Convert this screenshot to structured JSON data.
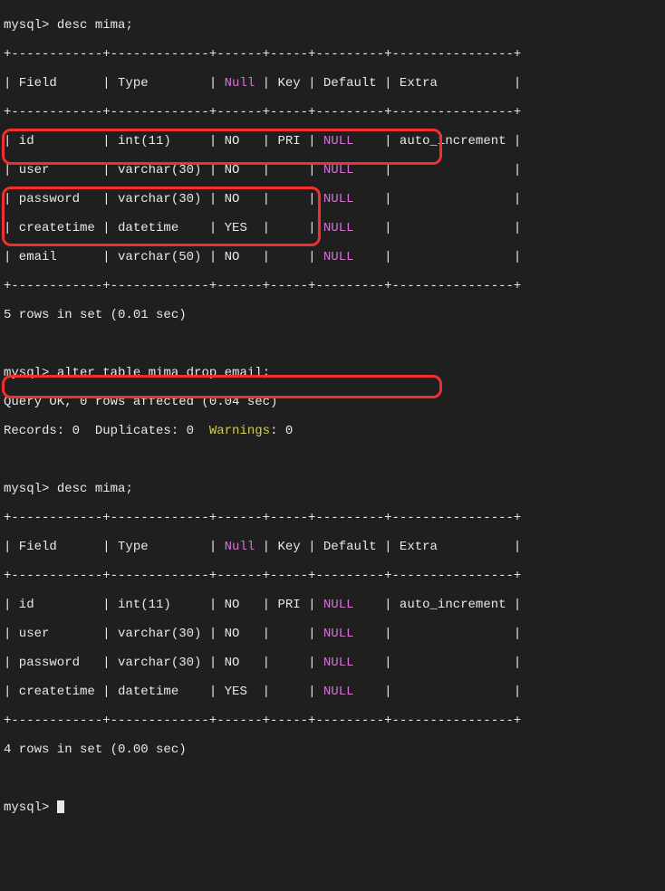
{
  "prompt": "mysql>",
  "cmd_desc": "desc mima;",
  "cmd_alter": "alter table mima drop email;",
  "alter_result1": "Query OK, 0 rows affected (0.04 sec)",
  "records_label": "Records: 0  Duplicates: 0  ",
  "warnings_label": "Warnings",
  "warnings_tail": ": 0",
  "summary1": "5 rows in set (0.01 sec)",
  "summary2": "4 rows in set (0.00 sec)",
  "hdr": {
    "top": "+------------+-------------+------+-----+---------+----------------+",
    "field": "| Field      ",
    "type": "| Type        ",
    "null1": "| ",
    "nullw": "Null",
    "null2": " ",
    "key": "| Key ",
    "default": "| Default ",
    "extra": "| Extra          |"
  },
  "table1_rows": [
    {
      "field": "| id         ",
      "type": "| int(11)     ",
      "null": "| NO   ",
      "key": "| PRI ",
      "def1": "| ",
      "defnull": "NULL",
      "def2": "    ",
      "extra": "| auto_increment |"
    },
    {
      "field": "| user       ",
      "type": "| varchar(30) ",
      "null": "| NO   ",
      "key": "|     ",
      "def1": "| ",
      "defnull": "NULL",
      "def2": "    ",
      "extra": "|                |"
    },
    {
      "field": "| password   ",
      "type": "| varchar(30) ",
      "null": "| NO   ",
      "key": "|     ",
      "def1": "| ",
      "defnull": "NULL",
      "def2": "    ",
      "extra": "|                |"
    },
    {
      "field": "| createtime ",
      "type": "| datetime    ",
      "null": "| YES  ",
      "key": "|     ",
      "def1": "| ",
      "defnull": "NULL",
      "def2": "    ",
      "extra": "|                |"
    },
    {
      "field": "| email      ",
      "type": "| varchar(50) ",
      "null": "| NO   ",
      "key": "|     ",
      "def1": "| ",
      "defnull": "NULL",
      "def2": "    ",
      "extra": "|                |"
    }
  ],
  "table2_rows": [
    {
      "field": "| id         ",
      "type": "| int(11)     ",
      "null": "| NO   ",
      "key": "| PRI ",
      "def1": "| ",
      "defnull": "NULL",
      "def2": "    ",
      "extra": "| auto_increment |"
    },
    {
      "field": "| user       ",
      "type": "| varchar(30) ",
      "null": "| NO   ",
      "key": "|     ",
      "def1": "| ",
      "defnull": "NULL",
      "def2": "    ",
      "extra": "|                |"
    },
    {
      "field": "| password   ",
      "type": "| varchar(30) ",
      "null": "| NO   ",
      "key": "|     ",
      "def1": "| ",
      "defnull": "NULL",
      "def2": "    ",
      "extra": "|                |"
    },
    {
      "field": "| createtime ",
      "type": "| datetime    ",
      "null": "| YES  ",
      "key": "|     ",
      "def1": "| ",
      "defnull": "NULL",
      "def2": "    ",
      "extra": "|                |"
    }
  ]
}
